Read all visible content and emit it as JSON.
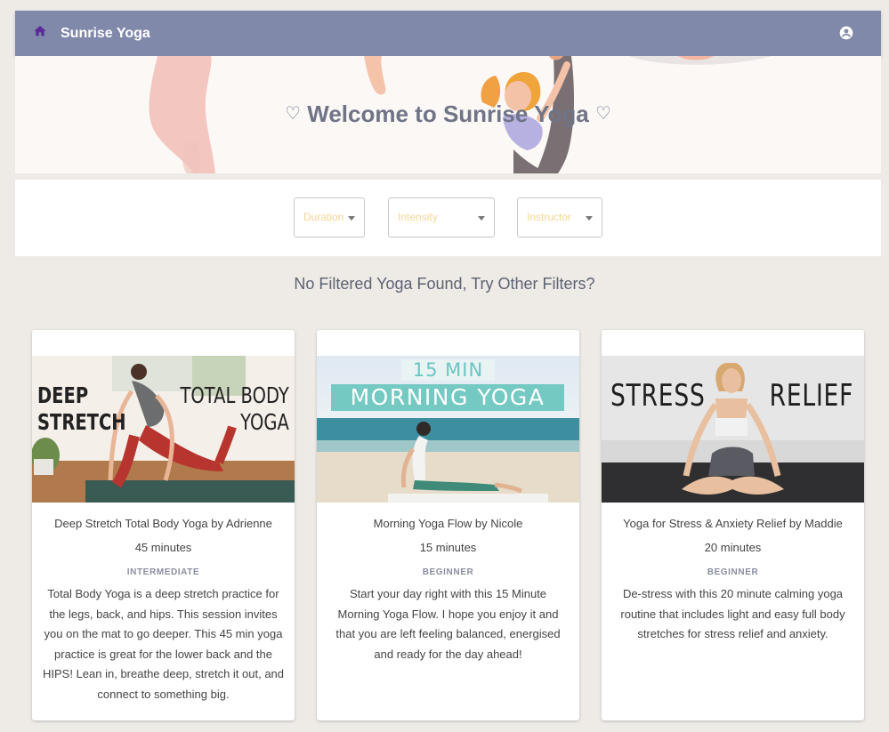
{
  "app": {
    "title": "Sunrise Yoga"
  },
  "hero": {
    "heading": "Welcome to Sunrise Yoga",
    "heart_left": "♡",
    "heart_right": "♡"
  },
  "filters": [
    {
      "label": "Duration"
    },
    {
      "label": "Intensity"
    },
    {
      "label": "Instructor"
    }
  ],
  "empty_message": "No Filtered Yoga Found, Try Other Filters?",
  "cards": [
    {
      "title": "Deep Stretch Total Body Yoga by Adrienne",
      "duration": "45 minutes",
      "level": "INTERMEDIATE",
      "description": "Total Body Yoga is a deep stretch practice for the legs, back, and hips. This session invites you on the mat to go deeper. This 45 min yoga practice is great for the lower back and the HIPS! Lean in, breathe deep, stretch it out, and connect to something big.",
      "thumb_text_left": [
        "DEEP",
        "STRETCH"
      ],
      "thumb_text_right": [
        "TOTAL BODY",
        "YOGA"
      ]
    },
    {
      "title": "Morning Yoga Flow by Nicole",
      "duration": "15 minutes",
      "level": "BEGINNER",
      "description": "Start your day right with this 15 Minute Morning Yoga Flow. I hope you enjoy it and that you are left feeling balanced, energised and ready for the day ahead!",
      "thumb_text_top": "15 MIN",
      "thumb_text_bottom": "MORNING YOGA"
    },
    {
      "title": "Yoga for Stress & Anxiety Relief by Maddie",
      "duration": "20 minutes",
      "level": "BEGINNER",
      "description": "De-stress with this 20 minute calming yoga routine that includes light and easy full body stretches for stress relief and anxiety.",
      "thumb_text_left": "STRESS",
      "thumb_text_right": "RELIEF"
    }
  ],
  "colors": {
    "appbar": "#8089a9",
    "page_bg": "#eeebe7",
    "placeholder": "#f5d597",
    "home_icon": "#5b2a9a"
  },
  "icons": {
    "home": "home-icon",
    "account": "account-circle-icon",
    "dropdown": "caret-down-icon"
  }
}
